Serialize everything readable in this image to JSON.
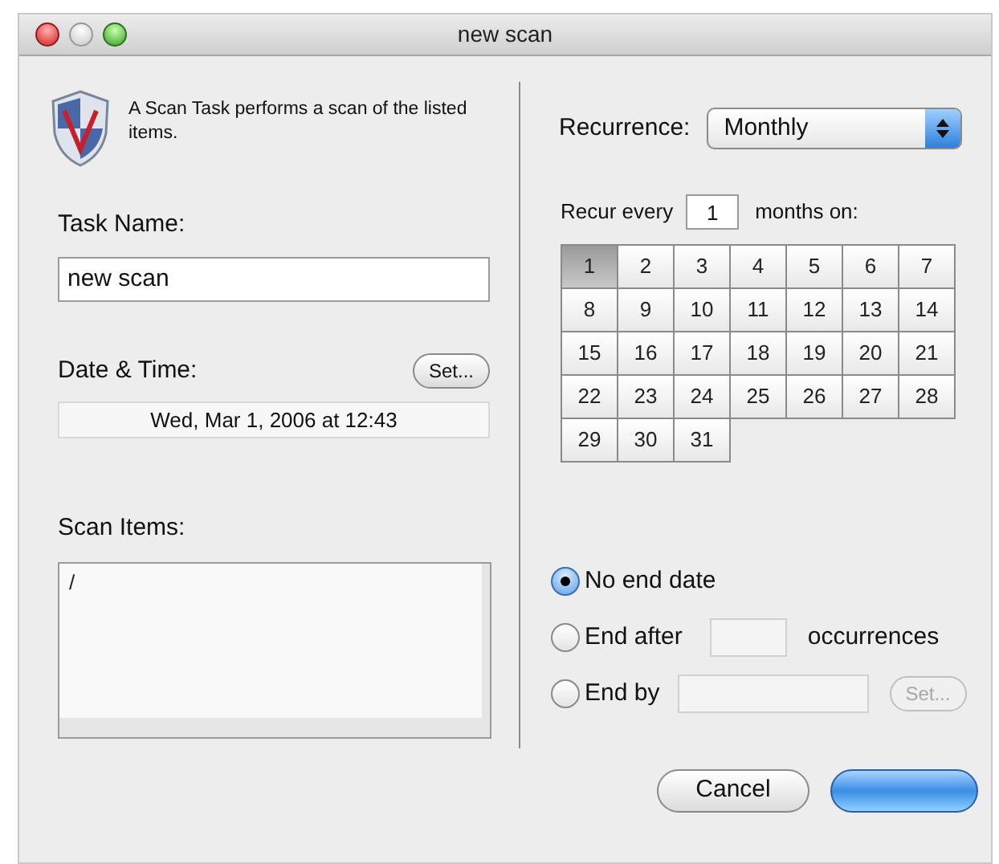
{
  "window": {
    "title": "new scan"
  },
  "intro": "A Scan Task performs a scan of the listed items.",
  "task_name": {
    "label": "Task Name:",
    "value": "new scan"
  },
  "date_time": {
    "label": "Date & Time:",
    "button": "Set...",
    "value": "Wed, Mar 1, 2006 at 12:43"
  },
  "scan_items": {
    "label": "Scan Items:",
    "items": [
      "/"
    ]
  },
  "recurrence": {
    "label": "Recurrence:",
    "value": "Monthly"
  },
  "recur_every": {
    "prefix": "Recur every",
    "value": "1",
    "suffix": "months on:"
  },
  "days": [
    {
      "label": "1",
      "selected": true
    },
    {
      "label": "2",
      "selected": false
    },
    {
      "label": "3",
      "selected": false
    },
    {
      "label": "4",
      "selected": false
    },
    {
      "label": "5",
      "selected": false
    },
    {
      "label": "6",
      "selected": false
    },
    {
      "label": "7",
      "selected": false
    },
    {
      "label": "8",
      "selected": false
    },
    {
      "label": "9",
      "selected": false
    },
    {
      "label": "10",
      "selected": false
    },
    {
      "label": "11",
      "selected": false
    },
    {
      "label": "12",
      "selected": false
    },
    {
      "label": "13",
      "selected": false
    },
    {
      "label": "14",
      "selected": false
    },
    {
      "label": "15",
      "selected": false
    },
    {
      "label": "16",
      "selected": false
    },
    {
      "label": "17",
      "selected": false
    },
    {
      "label": "18",
      "selected": false
    },
    {
      "label": "19",
      "selected": false
    },
    {
      "label": "20",
      "selected": false
    },
    {
      "label": "21",
      "selected": false
    },
    {
      "label": "22",
      "selected": false
    },
    {
      "label": "23",
      "selected": false
    },
    {
      "label": "24",
      "selected": false
    },
    {
      "label": "25",
      "selected": false
    },
    {
      "label": "26",
      "selected": false
    },
    {
      "label": "27",
      "selected": false
    },
    {
      "label": "28",
      "selected": false
    },
    {
      "label": "29",
      "selected": false
    },
    {
      "label": "30",
      "selected": false
    },
    {
      "label": "31",
      "selected": false
    }
  ],
  "end_options": [
    {
      "kind": "plain",
      "label": "No end date",
      "selected": true
    },
    {
      "kind": "count",
      "label": "End after",
      "suffix": "occurrences",
      "selected": false
    },
    {
      "kind": "date",
      "label": "End by",
      "button": "Set...",
      "disabled": true,
      "selected": false
    }
  ],
  "buttons": [
    {
      "label": "Cancel",
      "default": false
    },
    {
      "default": true
    }
  ]
}
